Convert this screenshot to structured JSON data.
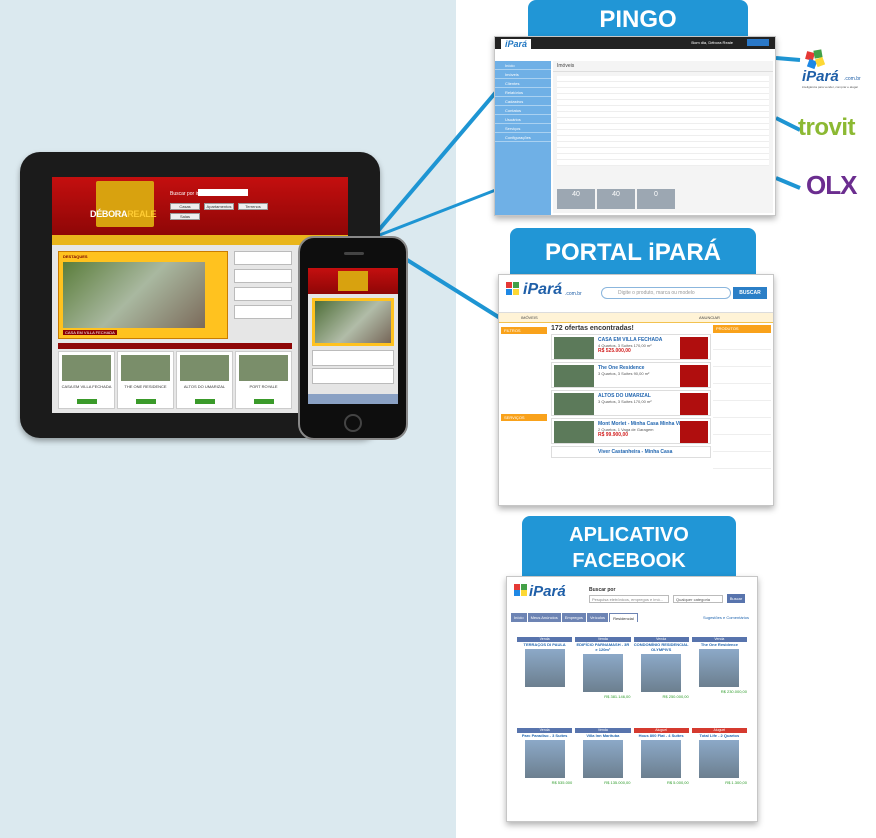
{
  "sections": {
    "pingo": "PINGO",
    "portal": "PORTAL iPARÁ",
    "facebook_line1": "APLICATIVO",
    "facebook_line2": "FACEBOOK"
  },
  "brands": {
    "ipara_name": "iPará",
    "ipara_domain": ".com.br",
    "ipara_tagline": "inteligência para vender, comprar e alugar",
    "trovit": "trovit",
    "olx": "OLX"
  },
  "tablet_site": {
    "logo_main": "DÉBORA",
    "logo_accent": "REALE",
    "search_label": "Buscar por imóvel",
    "buttons": [
      "Casas",
      "Apartamentos",
      "Terrenos",
      "Salas"
    ],
    "featured_tab": "DESTAQUES",
    "featured_caption": "CASA EM VILLA FECHADA",
    "cards": [
      "CASA EM VILLA FECHADA",
      "THE ONE RESIDENCE",
      "ALTOS DO UMARIZAL",
      "PORT ROYALE"
    ]
  },
  "pingo": {
    "brand": "iPará",
    "user": "Bom dia, Débora Reale",
    "menu": [
      "Início",
      "Imóveis",
      "Clientes",
      "Relatórios",
      "Cadastros",
      "Contatos",
      "Usuários",
      "Serviços",
      "Configurações"
    ],
    "title": "Imóveis",
    "stats": [
      {
        "value": "40"
      },
      {
        "value": "40"
      },
      {
        "value": "0"
      }
    ]
  },
  "portal": {
    "search_placeholder": "Digite o produto, marca ou modelo",
    "search_button": "BUSCAR",
    "nav_left": "IMÓVEIS",
    "nav_right": "ANUNCIAR",
    "filter_title": "FILTROS",
    "services_title": "SERVIÇOS",
    "results_count": "172 ofertas encontradas!",
    "results": [
      {
        "title": "CASA EM VILLA FECHADA",
        "desc": "4 Quartos, 3 Suítes 170,00 m²",
        "price": "R$ 525.000,00"
      },
      {
        "title": "The One Residence",
        "desc": "3 Quartos, 3 Suítes 90,00 m²",
        "price": ""
      },
      {
        "title": "ALTOS DO UMARIZAL",
        "desc": "3 Quartos, 3 Suítes 170,00 m²",
        "price": ""
      },
      {
        "title": "Mont Morlet - Minha Casa Minha Vida",
        "desc": "2 Quartos, 1 Vaga de Garagem",
        "price": "R$ 99.900,00"
      },
      {
        "title": "Viver Castanheira - Minha Casa",
        "desc": "",
        "price": ""
      }
    ],
    "right_title": "PRODUTOS"
  },
  "facebook": {
    "search_label": "Buscar por",
    "search_placeholder": "Pesquisa eletrônicos, empregos e imó...",
    "category": "Qualquer categoria",
    "search_button": "Buscar",
    "tabs": [
      "Início",
      "Meus Anúncios",
      "Empregos",
      "Veículos",
      "Residencial"
    ],
    "active_tab": "Residencial",
    "suggestions": "Sugestões e Comentários",
    "cards": [
      {
        "tag": "Venda",
        "title": "TERRAÇOS DI PAULA",
        "price": ""
      },
      {
        "tag": "Venda",
        "title": "EDIFÍCIO PARNAMASH - 3R e 120m²",
        "price": "R$ 381.146,00"
      },
      {
        "tag": "Venda",
        "title": "CONDOMÍNIO RESIDENCIAL OLYMPIVS",
        "price": "R$ 250.000,00"
      },
      {
        "tag": "Venda",
        "title": "The One Residence",
        "price": "R$ 230.000,00"
      },
      {
        "tag": "Venda",
        "title": "Parc Paradiso - 3 Suítes",
        "price": "R$ 535.000"
      },
      {
        "tag": "Venda",
        "title": "Villa Inn Marituba",
        "price": "R$ 135.000,00"
      },
      {
        "tag": "Aluguel",
        "title": "Hous 800 Flat - 4 Suítes",
        "price": "R$ 5.000,00"
      },
      {
        "tag": "Aluguel",
        "title": "Total Life - 2 Quartos",
        "price": "R$ 1.300,00"
      }
    ]
  },
  "colors": {
    "tab_blue": "#2196d6",
    "line_blue": "#1e95d3",
    "left_bg": "#dbe9ef"
  }
}
